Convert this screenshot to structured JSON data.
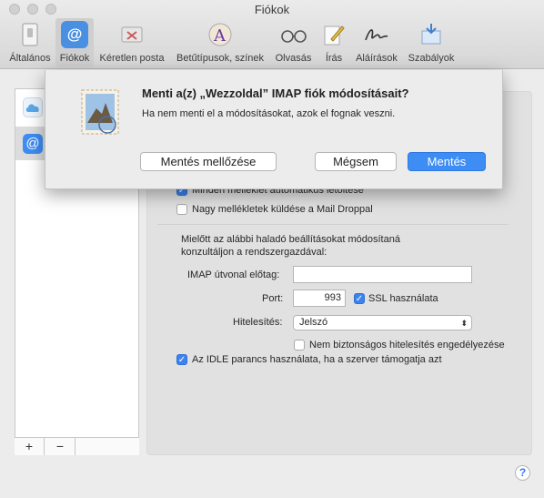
{
  "window": {
    "title": "Fiókok"
  },
  "toolbar": {
    "items": [
      {
        "label": "Általános",
        "icon": "general-switch-icon"
      },
      {
        "label": "Fiókok",
        "icon": "accounts-at-icon"
      },
      {
        "label": "Kéretlen posta",
        "icon": "junk-mail-icon"
      },
      {
        "label": "Betűtípusok, színek",
        "icon": "fonts-colors-icon"
      },
      {
        "label": "Olvasás",
        "icon": "reading-glasses-icon"
      },
      {
        "label": "Írás",
        "icon": "composing-pencil-icon"
      },
      {
        "label": "Aláírások",
        "icon": "signature-icon"
      },
      {
        "label": "Szabályok",
        "icon": "rules-icon"
      }
    ],
    "active": "Fiókok",
    "accent": "#4a90e2"
  },
  "sidebar": {
    "accounts": [
      {
        "icon": "cloud-icon"
      },
      {
        "icon": "at-sign-icon"
      }
    ],
    "add_label": "+",
    "remove_label": "−"
  },
  "settings": {
    "auto_download_label": "Minden melléklet automatikus letöltése",
    "auto_download_checked": true,
    "mail_drop_label": "Nagy mellékletek küldése a Mail Droppal",
    "mail_drop_checked": false,
    "advisory_text_1": "Mielőtt az alábbi haladó beállításokat módosítaná",
    "advisory_text_2": "konzultáljon a rendszergazdával:",
    "imap_prefix_label": "IMAP útvonal előtag:",
    "imap_prefix_value": "",
    "port_label": "Port:",
    "port_value": "993",
    "ssl_label": "SSL használata",
    "ssl_checked": true,
    "auth_label": "Hitelesítés:",
    "auth_value": "Jelszó",
    "insecure_auth_label": "Nem biztonságos hitelesítés engedélyezése",
    "insecure_auth_checked": false,
    "idle_label": "Az IDLE parancs használata, ha a szerver támogatja azt",
    "idle_checked": true,
    "help_label": "?"
  },
  "dialog": {
    "title": "Menti a(z) „Wezzoldal” IMAP fiók módosításait?",
    "message": "Ha nem menti el a módosításokat, azok el fognak veszni.",
    "dont_save_label": "Mentés mellőzése",
    "cancel_label": "Mégsem",
    "save_label": "Mentés",
    "icon": "mail-stamp-icon",
    "default_button_color": "#3d8df5"
  }
}
